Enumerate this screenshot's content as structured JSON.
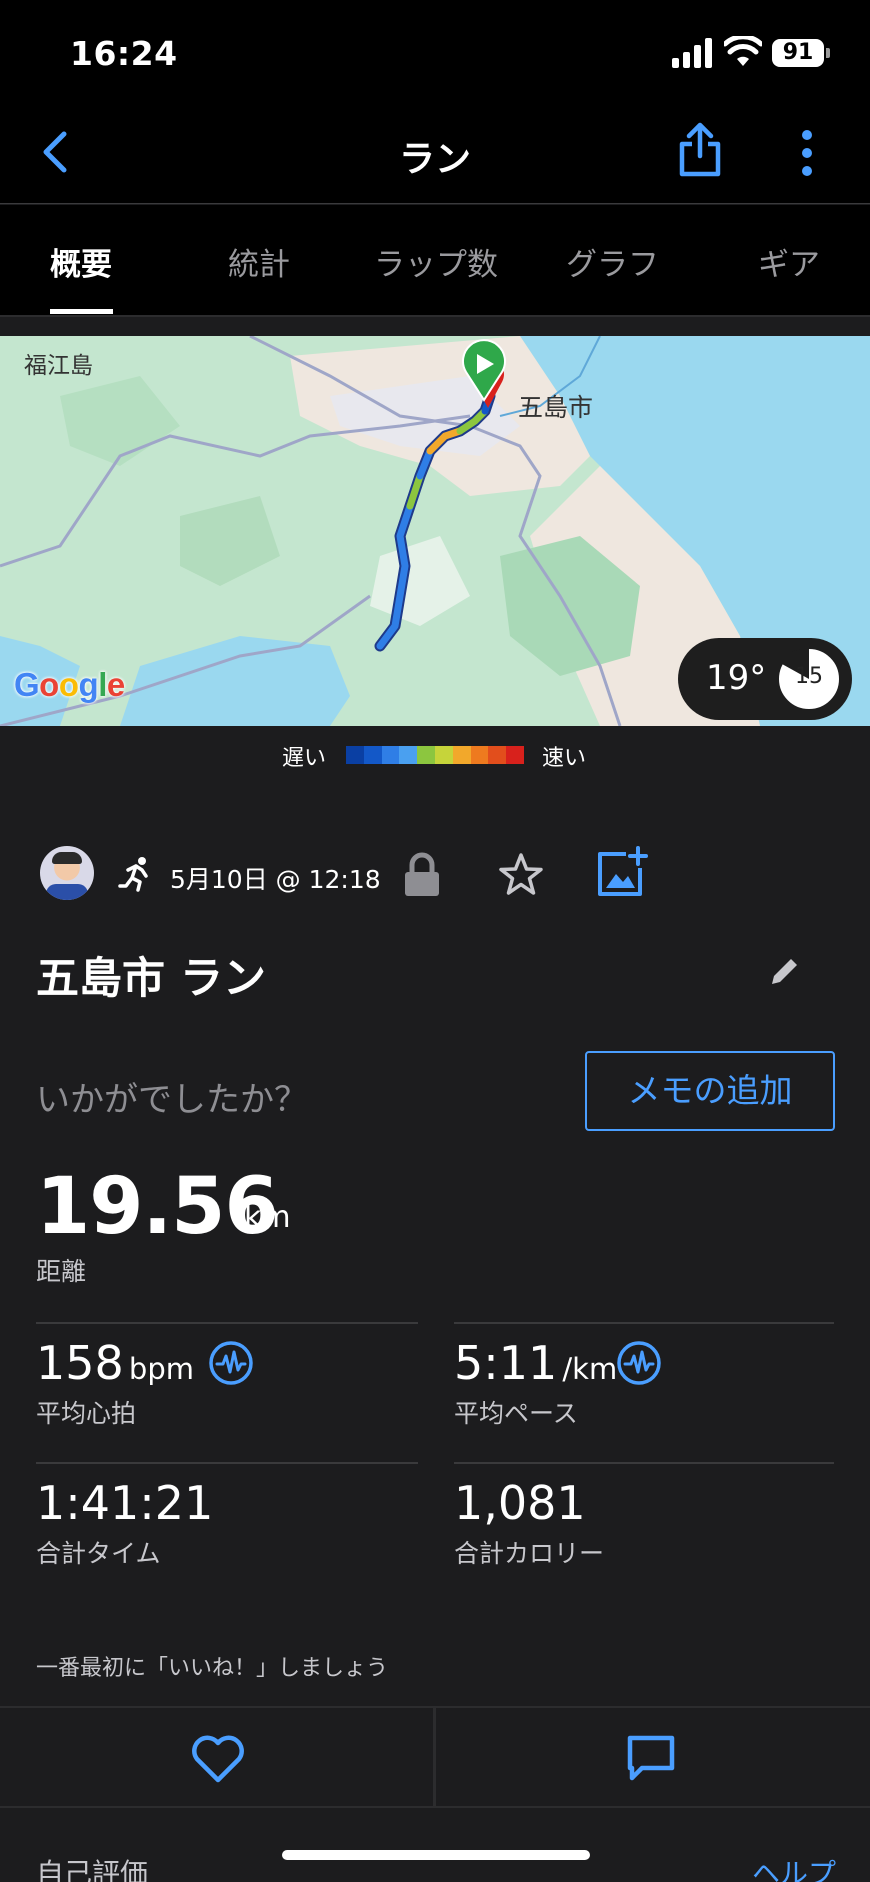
{
  "status_bar": {
    "time": "16:24",
    "battery": "91"
  },
  "nav": {
    "title": "ラン",
    "back_icon": "chevron-left-icon",
    "share_icon": "share-icon",
    "more_icon": "more-vertical-icon"
  },
  "tabs": [
    {
      "label": "概要",
      "active": true
    },
    {
      "label": "統計"
    },
    {
      "label": "ラップ数"
    },
    {
      "label": "グラフ"
    },
    {
      "label": "ギア"
    }
  ],
  "map": {
    "place_island": "福江島",
    "place_city": "五島市",
    "brand": "Google",
    "weather_temp": "19°",
    "wind": "15"
  },
  "pace_legend": {
    "slow": "遅い",
    "fast": "速い",
    "colors": [
      "#0a3fa3",
      "#1358c8",
      "#2f7ee6",
      "#4aa0f0",
      "#8cc63f",
      "#c6d43a",
      "#f2a82b",
      "#ee7a1f",
      "#e24e1c",
      "#d8211c"
    ]
  },
  "activity": {
    "date": "5月10日 @ 12:18",
    "title": "五島市 ラン",
    "prompt": "いかがでしたか？",
    "memo_button": "メモの追加"
  },
  "stats": {
    "distance": {
      "value": "19.56",
      "unit": "km",
      "label": "距離"
    },
    "avg_hr": {
      "value": "158",
      "unit": "bpm",
      "label": "平均心拍"
    },
    "avg_pace": {
      "value": "5:11",
      "unit": "/km",
      "label": "平均ペース"
    },
    "total_time": {
      "value": "1:41:21",
      "label": "合計タイム"
    },
    "calories": {
      "value": "1,081",
      "label": "合計カロリー"
    }
  },
  "social": {
    "like_prompt": "一番最初に「いいね！」しましょう"
  },
  "footer": {
    "self_eval": "自己評価",
    "help": "ヘルプ"
  },
  "colors": {
    "accent": "#4a9eff",
    "background": "#1c1c1e"
  }
}
